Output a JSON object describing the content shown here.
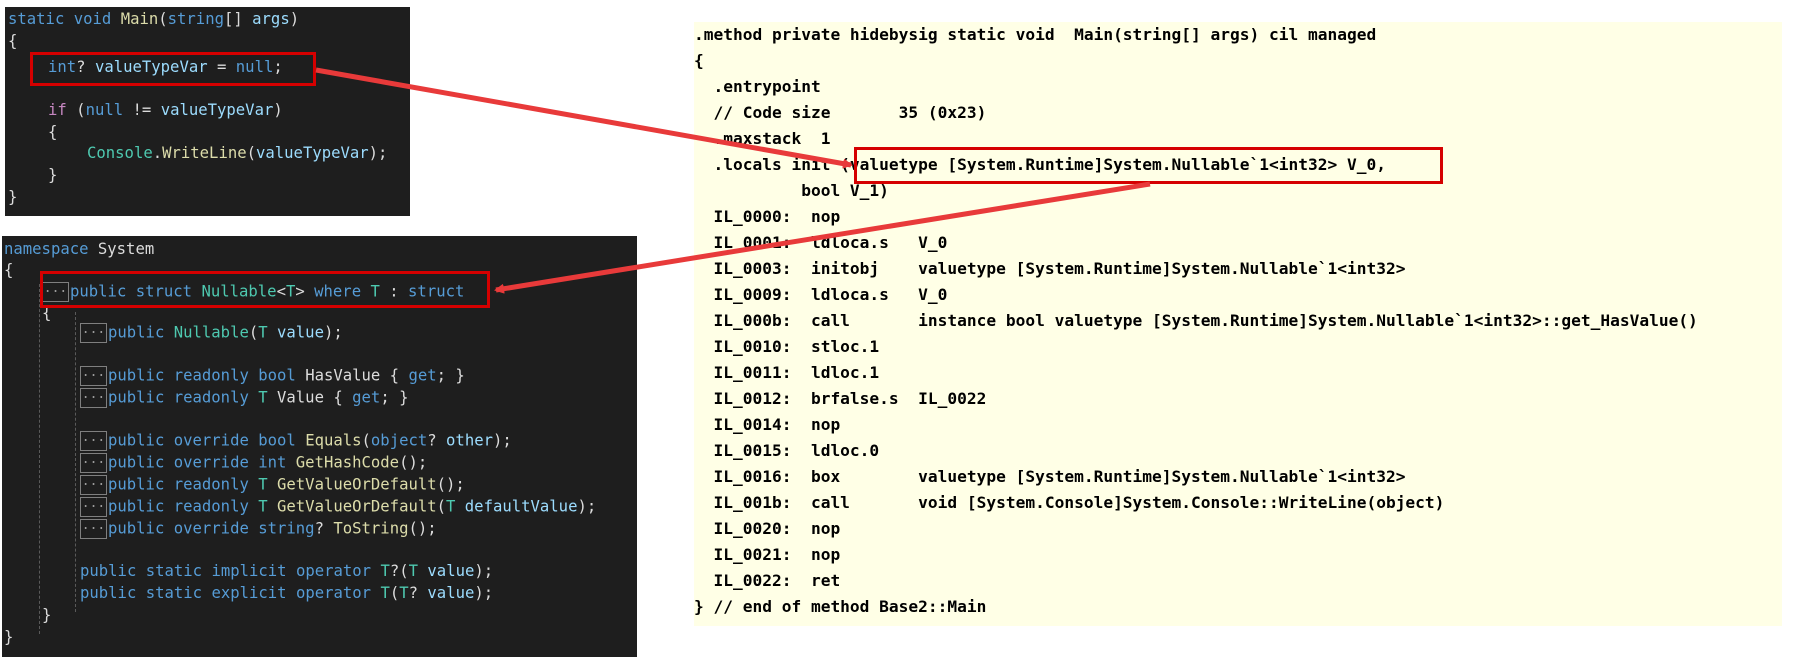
{
  "csharp_main": {
    "lines": [
      "static void Main(string[] args)",
      "{",
      "int? valueTypeVar = null;",
      "if (null != valueTypeVar)",
      "{",
      "Console.WriteLine(valueTypeVar);",
      "}",
      "}"
    ],
    "tokens": {
      "static": "static",
      "void": "void",
      "Main": "Main",
      "string": "string",
      "args": "args",
      "int": "int",
      "valueTypeVar": "valueTypeVar",
      "null": "null",
      "if": "if",
      "Console": "Console",
      "WriteLine": "WriteLine"
    }
  },
  "nullable_source": {
    "namespace_kw": "namespace",
    "namespace_name": "System",
    "fold_marker": "...",
    "tokens": {
      "public": "public",
      "struct": "struct",
      "Nullable": "Nullable",
      "T": "T",
      "where": "where",
      "value": "value",
      "readonly": "readonly",
      "bool": "bool",
      "HasValue": "HasValue",
      "Value": "Value",
      "get": "get",
      "override": "override",
      "Equals": "Equals",
      "object": "object",
      "other": "other",
      "int": "int",
      "GetHashCode": "GetHashCode",
      "GetValueOrDefault": "GetValueOrDefault",
      "defaultValue": "defaultValue",
      "string": "string",
      "ToString": "ToString",
      "static": "static",
      "implicit": "implicit",
      "explicit": "explicit",
      "operator": "operator"
    }
  },
  "il_code": {
    "lines": [
      ".method private hidebysig static void  Main(string[] args) cil managed",
      "{",
      "  .entrypoint",
      "  // Code size       35 (0x23)",
      "  .maxstack  1",
      "  .locals init (valuetype [System.Runtime]System.Nullable`1<int32> V_0,",
      "           bool V_1)",
      "  IL_0000:  nop",
      "  IL_0001:  ldloca.s   V_0",
      "  IL_0003:  initobj    valuetype [System.Runtime]System.Nullable`1<int32>",
      "  IL_0009:  ldloca.s   V_0",
      "  IL_000b:  call       instance bool valuetype [System.Runtime]System.Nullable`1<int32>::get_HasValue()",
      "  IL_0010:  stloc.1",
      "  IL_0011:  ldloc.1",
      "  IL_0012:  brfalse.s  IL_0022",
      "  IL_0014:  nop",
      "  IL_0015:  ldloc.0",
      "  IL_0016:  box        valuetype [System.Runtime]System.Nullable`1<int32>",
      "  IL_001b:  call       void [System.Console]System.Console::WriteLine(object)",
      "  IL_0020:  nop",
      "  IL_0021:  nop",
      "  IL_0022:  ret",
      "} // end of method Base2::Main"
    ]
  },
  "colors": {
    "dark_bg": "#1e1e1e",
    "il_bg": "#ffffe6",
    "highlight": "#d50000",
    "arrow": "#e83a3a",
    "keyword": "#569cd6",
    "type": "#4ec9b0",
    "method": "#dcdcaa",
    "variable": "#9cdcfe"
  }
}
